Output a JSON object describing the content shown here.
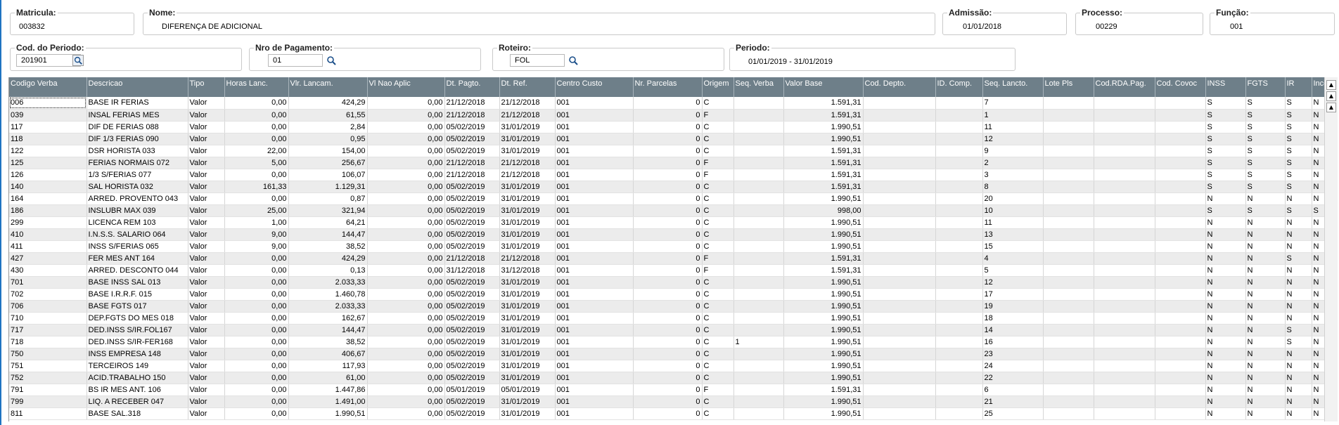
{
  "header": {
    "matricula": {
      "label": "Matricula:",
      "value": "003832"
    },
    "nome": {
      "label": "Nome:",
      "value": "DIFERENÇA DE ADICIONAL"
    },
    "admissao": {
      "label": "Admissão:",
      "value": "01/01/2018"
    },
    "processo": {
      "label": "Processo:",
      "value": "00229"
    },
    "funcao": {
      "label": "Função:",
      "value": "001"
    },
    "periodo_cod": {
      "label": "Cod. do Periodo:",
      "value": "201901"
    },
    "nro_pagamento": {
      "label": "Nro de Pagamento:",
      "value": "01"
    },
    "roteiro": {
      "label": "Roteiro:",
      "value": "FOL"
    },
    "periodo": {
      "label": "Periodo:",
      "value": "01/01/2019 - 31/01/2019"
    }
  },
  "icons": {
    "search": "search-icon",
    "scroll_top": "scroll-to-top-icon",
    "scroll_up": "scroll-up-icon"
  },
  "columns": [
    "Codigo Verba",
    "Descricao",
    "Tipo",
    "Horas Lanc.",
    "Vlr. Lancam.",
    "Vl Nao Aplic",
    "Dt. Pagto.",
    "Dt. Ref.",
    "Centro Custo",
    "Nr. Parcelas",
    "Origem",
    "Seq. Verba",
    "Valor Base",
    "Cod. Depto.",
    "ID. Comp.",
    "Seq. Lancto.",
    "Lote Pls",
    "Cod.RDA.Pag.",
    "Cod. Covoc",
    "INSS",
    "FGTS",
    "IR",
    "Inco"
  ],
  "rows": [
    [
      "006",
      "BASE IR FERIAS",
      "Valor",
      "0,00",
      "424,29",
      "0,00",
      "21/12/2018",
      "21/12/2018",
      "001",
      "0",
      "C",
      "",
      "1.591,31",
      "",
      "",
      "7",
      "",
      "",
      "",
      "S",
      "S",
      "S",
      "N"
    ],
    [
      "039",
      "INSAL FERIAS MES",
      "Valor",
      "0,00",
      "61,55",
      "0,00",
      "21/12/2018",
      "21/12/2018",
      "001",
      "0",
      "F",
      "",
      "1.591,31",
      "",
      "",
      "1",
      "",
      "",
      "",
      "S",
      "S",
      "S",
      "N"
    ],
    [
      "117",
      "DIF DE FERIAS 088",
      "Valor",
      "0,00",
      "2,84",
      "0,00",
      "05/02/2019",
      "31/01/2019",
      "001",
      "0",
      "C",
      "",
      "1.990,51",
      "",
      "",
      "11",
      "",
      "",
      "",
      "S",
      "S",
      "S",
      "N"
    ],
    [
      "118",
      "DIF 1/3 FERIAS 090",
      "Valor",
      "0,00",
      "0,95",
      "0,00",
      "05/02/2019",
      "31/01/2019",
      "001",
      "0",
      "C",
      "",
      "1.990,51",
      "",
      "",
      "12",
      "",
      "",
      "",
      "S",
      "S",
      "S",
      "N"
    ],
    [
      "122",
      "DSR HORISTA 033",
      "Valor",
      "22,00",
      "154,00",
      "0,00",
      "05/02/2019",
      "31/01/2019",
      "001",
      "0",
      "C",
      "",
      "1.591,31",
      "",
      "",
      "9",
      "",
      "",
      "",
      "S",
      "S",
      "S",
      "N"
    ],
    [
      "125",
      "FERIAS NORMAIS 072",
      "Valor",
      "5,00",
      "256,67",
      "0,00",
      "21/12/2018",
      "21/12/2018",
      "001",
      "0",
      "F",
      "",
      "1.591,31",
      "",
      "",
      "2",
      "",
      "",
      "",
      "S",
      "S",
      "S",
      "N"
    ],
    [
      "126",
      "1/3 S/FERIAS 077",
      "Valor",
      "0,00",
      "106,07",
      "0,00",
      "21/12/2018",
      "21/12/2018",
      "001",
      "0",
      "F",
      "",
      "1.591,31",
      "",
      "",
      "3",
      "",
      "",
      "",
      "S",
      "S",
      "S",
      "N"
    ],
    [
      "140",
      "SAL HORISTA 032",
      "Valor",
      "161,33",
      "1.129,31",
      "0,00",
      "05/02/2019",
      "31/01/2019",
      "001",
      "0",
      "C",
      "",
      "1.591,31",
      "",
      "",
      "8",
      "",
      "",
      "",
      "S",
      "S",
      "S",
      "N"
    ],
    [
      "164",
      "ARRED. PROVENTO 043",
      "Valor",
      "0,00",
      "0,87",
      "0,00",
      "05/02/2019",
      "31/01/2019",
      "001",
      "0",
      "C",
      "",
      "1.990,51",
      "",
      "",
      "20",
      "",
      "",
      "",
      "N",
      "N",
      "N",
      "N"
    ],
    [
      "186",
      "INSLUBR MAX 039",
      "Valor",
      "25,00",
      "321,94",
      "0,00",
      "05/02/2019",
      "31/01/2019",
      "001",
      "0",
      "C",
      "",
      "998,00",
      "",
      "",
      "10",
      "",
      "",
      "",
      "S",
      "S",
      "S",
      "S"
    ],
    [
      "299",
      "LICENCA REM 103",
      "Valor",
      "1,00",
      "64,21",
      "0,00",
      "05/02/2019",
      "31/01/2019",
      "001",
      "0",
      "C",
      "",
      "1.990,51",
      "",
      "",
      "11",
      "",
      "",
      "",
      "N",
      "N",
      "N",
      "N"
    ],
    [
      "410",
      "I.N.S.S. SALARIO 064",
      "Valor",
      "9,00",
      "144,47",
      "0,00",
      "05/02/2019",
      "31/01/2019",
      "001",
      "0",
      "C",
      "",
      "1.990,51",
      "",
      "",
      "13",
      "",
      "",
      "",
      "N",
      "N",
      "N",
      "N"
    ],
    [
      "411",
      "INSS  S/FERIAS 065",
      "Valor",
      "9,00",
      "38,52",
      "0,00",
      "05/02/2019",
      "31/01/2019",
      "001",
      "0",
      "C",
      "",
      "1.990,51",
      "",
      "",
      "15",
      "",
      "",
      "",
      "N",
      "N",
      "N",
      "N"
    ],
    [
      "427",
      "FER MES ANT 164",
      "Valor",
      "0,00",
      "424,29",
      "0,00",
      "21/12/2018",
      "21/12/2018",
      "001",
      "0",
      "F",
      "",
      "1.591,31",
      "",
      "",
      "4",
      "",
      "",
      "",
      "N",
      "N",
      "S",
      "N"
    ],
    [
      "430",
      "ARRED. DESCONTO 044",
      "Valor",
      "0,00",
      "0,13",
      "0,00",
      "31/12/2018",
      "31/12/2018",
      "001",
      "0",
      "F",
      "",
      "1.591,31",
      "",
      "",
      "5",
      "",
      "",
      "",
      "N",
      "N",
      "N",
      "N"
    ],
    [
      "701",
      "BASE INSS SAL 013",
      "Valor",
      "0,00",
      "2.033,33",
      "0,00",
      "05/02/2019",
      "31/01/2019",
      "001",
      "0",
      "C",
      "",
      "1.990,51",
      "",
      "",
      "12",
      "",
      "",
      "",
      "N",
      "N",
      "N",
      "N"
    ],
    [
      "702",
      "BASE I.R.R.F. 015",
      "Valor",
      "0,00",
      "1.460,78",
      "0,00",
      "05/02/2019",
      "31/01/2019",
      "001",
      "0",
      "C",
      "",
      "1.990,51",
      "",
      "",
      "17",
      "",
      "",
      "",
      "N",
      "N",
      "N",
      "N"
    ],
    [
      "706",
      "BASE FGTS 017",
      "Valor",
      "0,00",
      "2.033,33",
      "0,00",
      "05/02/2019",
      "31/01/2019",
      "001",
      "0",
      "C",
      "",
      "1.990,51",
      "",
      "",
      "19",
      "",
      "",
      "",
      "N",
      "N",
      "N",
      "N"
    ],
    [
      "710",
      "DEP.FGTS DO MES 018",
      "Valor",
      "0,00",
      "162,67",
      "0,00",
      "05/02/2019",
      "31/01/2019",
      "001",
      "0",
      "C",
      "",
      "1.990,51",
      "",
      "",
      "18",
      "",
      "",
      "",
      "N",
      "N",
      "N",
      "N"
    ],
    [
      "717",
      "DED.INSS S/IR.FOL167",
      "Valor",
      "0,00",
      "144,47",
      "0,00",
      "05/02/2019",
      "31/01/2019",
      "001",
      "0",
      "C",
      "",
      "1.990,51",
      "",
      "",
      "14",
      "",
      "",
      "",
      "N",
      "N",
      "S",
      "N"
    ],
    [
      "718",
      "DED.INSS S/IR-FER168",
      "Valor",
      "0,00",
      "38,52",
      "0,00",
      "05/02/2019",
      "31/01/2019",
      "001",
      "0",
      "C",
      "1",
      "1.990,51",
      "",
      "",
      "16",
      "",
      "",
      "",
      "N",
      "N",
      "S",
      "N"
    ],
    [
      "750",
      "INSS EMPRESA 148",
      "Valor",
      "0,00",
      "406,67",
      "0,00",
      "05/02/2019",
      "31/01/2019",
      "001",
      "0",
      "C",
      "",
      "1.990,51",
      "",
      "",
      "23",
      "",
      "",
      "",
      "N",
      "N",
      "N",
      "N"
    ],
    [
      "751",
      "TERCEIROS 149",
      "Valor",
      "0,00",
      "117,93",
      "0,00",
      "05/02/2019",
      "31/01/2019",
      "001",
      "0",
      "C",
      "",
      "1.990,51",
      "",
      "",
      "24",
      "",
      "",
      "",
      "N",
      "N",
      "N",
      "N"
    ],
    [
      "752",
      "ACID.TRABALHO 150",
      "Valor",
      "0,00",
      "61,00",
      "0,00",
      "05/02/2019",
      "31/01/2019",
      "001",
      "0",
      "C",
      "",
      "1.990,51",
      "",
      "",
      "22",
      "",
      "",
      "",
      "N",
      "N",
      "N",
      "N"
    ],
    [
      "791",
      "BS IR MES ANT. 106",
      "Valor",
      "0,00",
      "1.447,86",
      "0,00",
      "05/01/2019",
      "05/01/2019",
      "001",
      "0",
      "F",
      "",
      "1.591,31",
      "",
      "",
      "6",
      "",
      "",
      "",
      "N",
      "N",
      "N",
      "N"
    ],
    [
      "799",
      "LIQ. A RECEBER 047",
      "Valor",
      "0,00",
      "1.491,00",
      "0,00",
      "05/02/2019",
      "31/01/2019",
      "001",
      "0",
      "C",
      "",
      "1.990,51",
      "",
      "",
      "21",
      "",
      "",
      "",
      "N",
      "N",
      "N",
      "N"
    ],
    [
      "811",
      "BASE SAL.318",
      "Valor",
      "0,00",
      "1.990,51",
      "0,00",
      "05/02/2019",
      "31/01/2019",
      "001",
      "0",
      "C",
      "",
      "1.990,51",
      "",
      "",
      "25",
      "",
      "",
      "",
      "N",
      "N",
      "N",
      "N"
    ]
  ]
}
